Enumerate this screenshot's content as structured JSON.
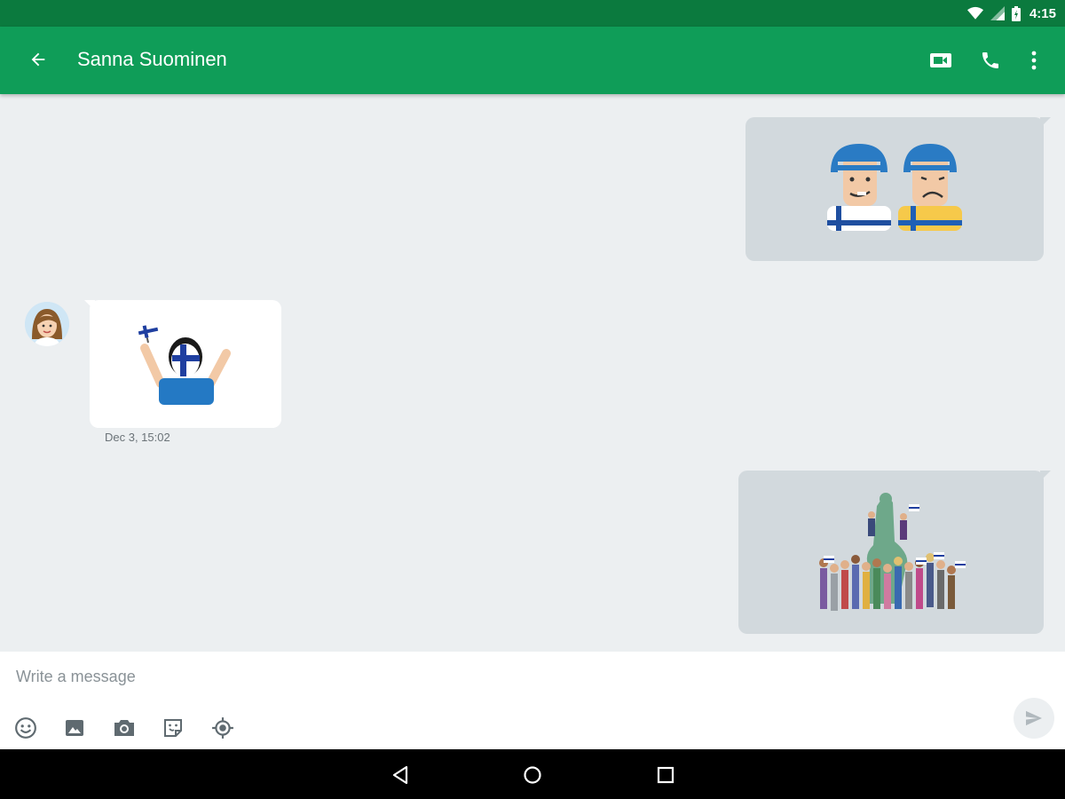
{
  "status_bar": {
    "time": "4:15",
    "icons": [
      "wifi-icon",
      "cell-signal-icon",
      "battery-icon"
    ]
  },
  "app_bar": {
    "contact_name": "Sanna Suominen",
    "icons": [
      "back-arrow-icon",
      "video-call-icon",
      "phone-icon",
      "more-vert-icon"
    ],
    "color": "#0f9d58",
    "status_color": "#0b7a3e"
  },
  "messages": [
    {
      "direction": "outgoing",
      "type": "sticker",
      "sticker": "two-hockey-players-finland-sweden-sticker"
    },
    {
      "direction": "incoming",
      "type": "sticker",
      "sticker": "finnish-flag-fan-sticker",
      "timestamp": "Dec 3, 15:02"
    },
    {
      "direction": "outgoing",
      "type": "sticker",
      "sticker": "crowd-at-statue-celebration-sticker"
    }
  ],
  "composer": {
    "placeholder": "Write a message",
    "value": "",
    "tools": [
      "emoji-icon",
      "image-icon",
      "camera-icon",
      "sticker-icon",
      "location-icon"
    ],
    "send_icon": "send-icon"
  },
  "nav_bar": {
    "buttons": [
      "back-triangle-icon",
      "home-circle-icon",
      "recents-square-icon"
    ]
  }
}
